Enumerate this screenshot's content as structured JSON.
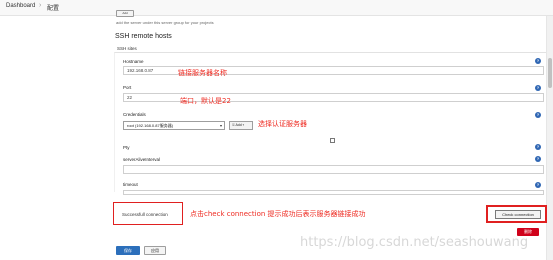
{
  "breadcrumb": {
    "dashboard": "Dashboard",
    "separator": "›",
    "config": "配置"
  },
  "top_section": {
    "small_button_label": "Add",
    "hint_text": "add the server under this server group for your projects"
  },
  "section": {
    "title": "SSH remote hosts",
    "subtitle": "SSH sites"
  },
  "form": {
    "hostname": {
      "label": "Hostname",
      "value": "192.168.0.87"
    },
    "port": {
      "label": "Port",
      "value": "22"
    },
    "credentials": {
      "label": "Credentials",
      "selected": "root (192.168.0.87服务器)",
      "add_label": "Add ▾"
    },
    "pty": {
      "label": "Pty"
    },
    "server_alive": {
      "label": "serverAliveInterval",
      "value": ""
    },
    "timeout": {
      "label": "timeout",
      "value": ""
    }
  },
  "status": {
    "success_text": "Successfull connection"
  },
  "buttons": {
    "check_connection": "Check connection",
    "delete": "删除",
    "save": "保存",
    "apply": "应用"
  },
  "annotations": {
    "hostname_note": "链接服务器名称",
    "port_note": "端口，默认是22",
    "credentials_note": "选择认证服务器",
    "check_note": "点击check connection 提示成功后表示服务器链接成功"
  },
  "help_icon_text": "?",
  "watermark": "https://blog.csdn.net/seashouwang",
  "colors": {
    "annotation_red": "#ee2b22",
    "primary_blue": "#2c6fbb",
    "danger_red": "#d0021b"
  }
}
